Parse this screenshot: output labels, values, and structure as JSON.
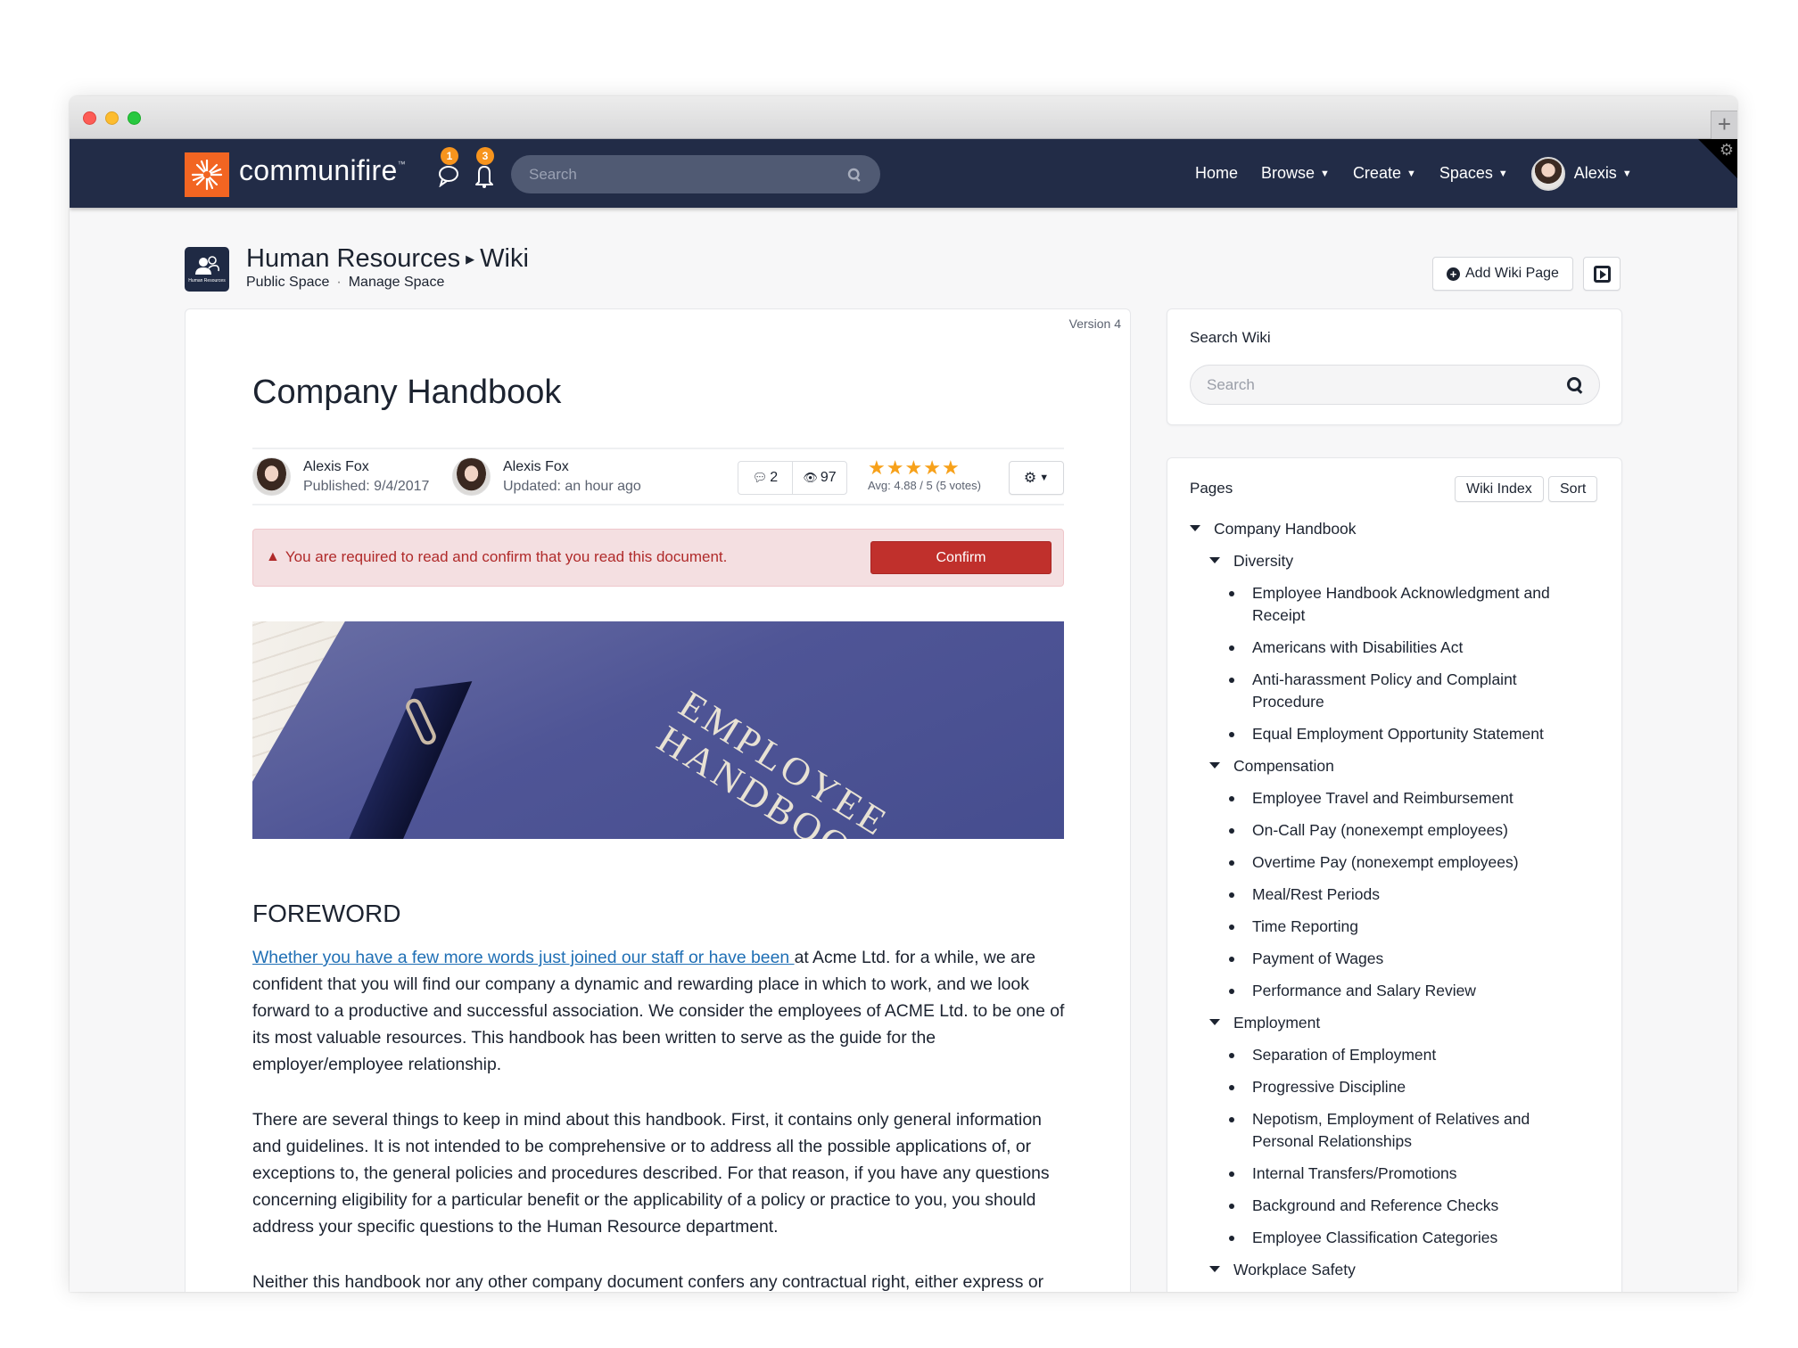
{
  "browser": {
    "new_tab_label": "+"
  },
  "navbar": {
    "brand": "communifire",
    "trademark": "™",
    "messages_badge": "1",
    "notifications_badge": "3",
    "search_placeholder": "Search",
    "menu": [
      {
        "label": "Home",
        "has_caret": false
      },
      {
        "label": "Browse",
        "has_caret": true
      },
      {
        "label": "Create",
        "has_caret": true
      },
      {
        "label": "Spaces",
        "has_caret": true
      }
    ],
    "user_name": "Alexis",
    "colors": {
      "bar": "#222c47",
      "brand_orange": "#f26522",
      "badge": "#f7941d"
    }
  },
  "space": {
    "icon_caption": "Human Resources",
    "name": "Human Resources",
    "section": "Wiki",
    "visibility": "Public Space",
    "manage_link": "Manage Space",
    "add_button": "Add Wiki Page"
  },
  "article": {
    "version": "Version 4",
    "title": "Company Handbook",
    "publisher": {
      "name": "Alexis Fox",
      "date": "Published: 9/4/2017"
    },
    "updater": {
      "name": "Alexis Fox",
      "date": "Updated: an hour ago"
    },
    "comments": "2",
    "views": "97",
    "rating": {
      "stars": 5,
      "text": "Avg: 4.88 / 5 (5 votes)"
    },
    "alert": {
      "text": "You are required to read and confirm that you read this document.",
      "button": "Confirm",
      "color": "#c0302c"
    },
    "hero_caption_line1": "EMPLOYEE",
    "hero_caption_line2": "HANDBOOK",
    "heading": "FOREWORD",
    "p1_link": "Whether you have a few more words just joined our staff or have been ",
    "p1_rest": "at Acme Ltd. for a while, we are confident that you will find our company a dynamic and rewarding place in which to work, and we look forward to a productive and successful association. We consider the employees of ACME Ltd. to be one of its most valuable resources. This handbook has been written to serve as the guide for the employer/employee relationship.",
    "p2": "There are several things to keep in mind about this handbook. First, it contains only general information and guidelines. It is not intended to be comprehensive or to address all the possible applications of, or exceptions to, the general policies and procedures described. For that reason, if you have any questions concerning eligibility for a particular benefit or the applicability of a policy or practice to you, you should address your specific questions to the Human Resource department.",
    "p3": "Neither this handbook nor any other company document confers any contractual right, either express or implied, to remain in the company's employ. Nor does it guarantee any fixed terms and conditions"
  },
  "sidebar": {
    "search_title": "Search Wiki",
    "search_placeholder": "Search",
    "pages_title": "Pages",
    "wiki_index_button": "Wiki Index",
    "sort_button": "Sort",
    "tree": {
      "root": "Company Handbook",
      "groups": [
        {
          "name": "Diversity",
          "items": [
            "Employee Handbook Acknowledgment and Receipt",
            "Americans with Disabilities Act",
            "Anti-harassment Policy and Complaint Procedure",
            "Equal Employment Opportunity Statement"
          ]
        },
        {
          "name": "Compensation",
          "items": [
            "Employee Travel and Reimbursement",
            "On-Call Pay (nonexempt employees)",
            "Overtime Pay (nonexempt employees)",
            "Meal/Rest Periods",
            "Time Reporting",
            "Payment of Wages",
            "Performance and Salary Review"
          ]
        },
        {
          "name": "Employment",
          "items": [
            "Separation of Employment",
            "Progressive Discipline",
            "Nepotism, Employment of Relatives and Personal Relationships",
            "Internal Transfers/Promotions",
            "Background and Reference Checks",
            "Employee Classification Categories"
          ]
        },
        {
          "name": "Workplace Safety",
          "items": []
        }
      ]
    }
  }
}
